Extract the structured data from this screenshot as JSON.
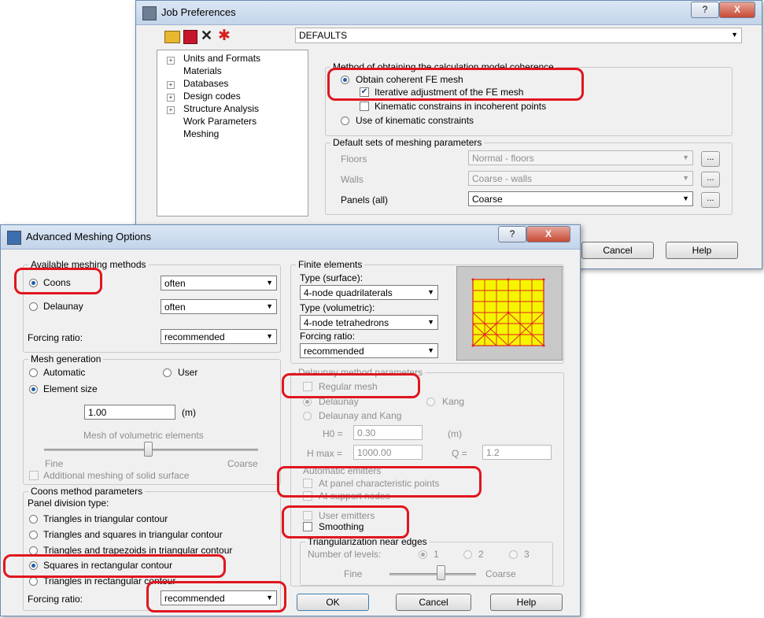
{
  "job_prefs": {
    "title": "Job Preferences",
    "help_btn": "?",
    "close_btn": "X",
    "defaults_value": "DEFAULTS",
    "tree": [
      "Units and Formats",
      "Materials",
      "Databases",
      "Design codes",
      "Structure Analysis",
      "Work Parameters",
      "Meshing"
    ],
    "method_group": "Method of obtaining the calculation model coherence",
    "obtain_coherent": "Obtain coherent FE mesh",
    "iterative": "Iterative adjustment of the FE mesh",
    "kinematic_incoherent": "Kinematic constrains in incoherent points",
    "use_kinematic": "Use of kinematic constraints",
    "default_sets_group": "Default sets of meshing parameters",
    "floors_label": "Floors",
    "floors_value": "Normal - floors",
    "walls_label": "Walls",
    "walls_value": "Coarse - walls",
    "panels_label": "Panels (all)",
    "panels_value": "Coarse",
    "ellipsis": "...",
    "cancel": "Cancel",
    "help": "Help"
  },
  "adv": {
    "title": "Advanced Meshing Options",
    "help_btn": "?",
    "close_btn": "X",
    "available_group": "Available meshing methods",
    "coons": "Coons",
    "coons_value": "often",
    "delaunay": "Delaunay",
    "delaunay_value": "often",
    "forcing_ratio": "Forcing ratio:",
    "forcing_value": "recommended",
    "mesh_gen_group": "Mesh generation",
    "automatic": "Automatic",
    "user": "User",
    "element_size": "Element size",
    "size_value": "1.00",
    "size_unit": "(m)",
    "mesh_volumetric": "Mesh of volumetric elements",
    "fine": "Fine",
    "coarse": "Coarse",
    "additional_meshing": "Additional meshing of solid surface",
    "coons_params_group": "Coons method parameters",
    "panel_division": "Panel division type:",
    "div_options": [
      "Triangles in triangular contour",
      "Triangles and squares in triangular contour",
      "Triangles and trapezoids in triangular contour",
      "Squares in rectangular contour",
      "Triangles in rectangular contour"
    ],
    "forcing_ratio2": "Forcing ratio:",
    "forcing_value2": "recommended",
    "finite_group": "Finite elements",
    "type_surface": "Type (surface):",
    "surface_value": "4-node quadrilaterals",
    "type_volumetric": "Type (volumetric):",
    "volumetric_value": "4-node tetrahedrons",
    "fe_forcing": "Forcing ratio:",
    "fe_forcing_value": "recommended",
    "delaunay_params_group": "Delaunay method parameters",
    "regular_mesh": "Regular mesh",
    "d_delaunay": "Delaunay",
    "d_kang": "Kang",
    "d_delaunay_kang": "Delaunay and Kang",
    "h0_label": "H0 =",
    "h0_value": "0.30",
    "h0_unit": "(m)",
    "hmax_label": "H max =",
    "hmax_value": "1000.00",
    "q_label": "Q =",
    "q_value": "1.2",
    "auto_emitters": "Automatic emitters",
    "at_panel": "At panel characteristic points",
    "at_support": "At support nodes",
    "user_emitters": "User emitters",
    "smoothing": "Smoothing",
    "triang_group": "Triangularization near edges",
    "num_levels": "Number of levels:",
    "lvl1": "1",
    "lvl2": "2",
    "lvl3": "3",
    "tfine": "Fine",
    "tcoarse": "Coarse",
    "ok": "OK",
    "cancel": "Cancel",
    "help": "Help"
  },
  "colors": {
    "highlight": "#e0161f",
    "mesh_fill": "#f5f500",
    "mesh_lines": "#e02020",
    "preview_bg": "#c8c8c8"
  }
}
